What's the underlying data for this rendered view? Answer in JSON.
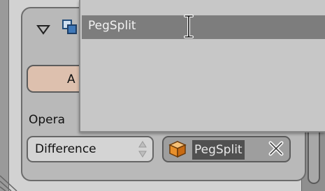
{
  "modifier": {
    "apply_label": "A",
    "operation_label": "Opera",
    "operation_value": "Difference",
    "object_value": "PegSplit"
  },
  "popup": {
    "items": [
      {
        "label": "PegSplit"
      }
    ]
  },
  "icons": {
    "collapse": "disclosure-triangle-down-icon",
    "modifier_type": "modifier-type-icon",
    "object": "mesh-cube-icon",
    "clear": "clear-x-icon",
    "cursor": "text-i-beam-cursor-icon",
    "grip": "corner-resize-grip-icon"
  },
  "colors": {
    "object_icon": "#e8902c",
    "highlight": "#505050",
    "apply_button": "#ddc0ae"
  }
}
